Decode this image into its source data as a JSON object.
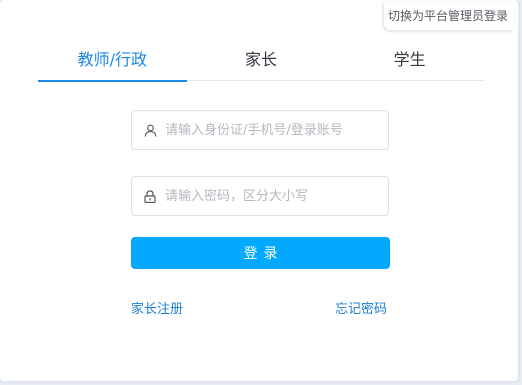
{
  "corner_link": "切换为平台管理员登录",
  "tabs": [
    {
      "label": "教师/行政",
      "active": true
    },
    {
      "label": "家长",
      "active": false
    },
    {
      "label": "学生",
      "active": false
    }
  ],
  "form": {
    "account_placeholder": "请输入身份证/手机号/登录账号",
    "password_placeholder": "请输入密码，区分大小写",
    "login_label": "登录"
  },
  "links": {
    "register": "家长注册",
    "forgot": "忘记密码"
  },
  "colors": {
    "accent": "#1e88e5",
    "button": "#02a9ff",
    "link": "#1e7fd6"
  }
}
